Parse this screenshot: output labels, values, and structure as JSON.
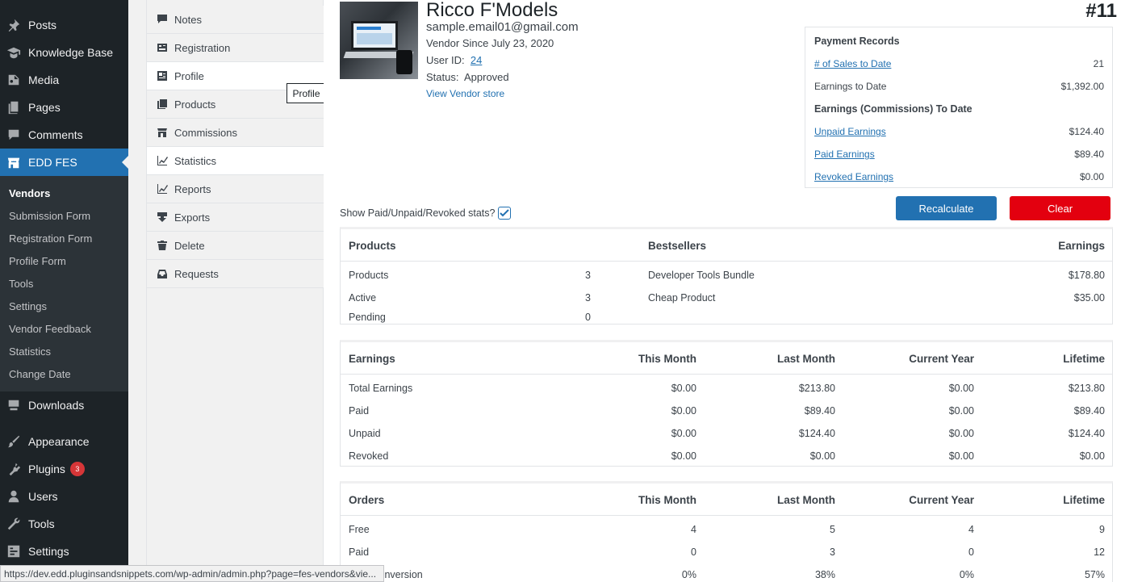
{
  "admin_menu": {
    "items": [
      {
        "label": "Posts",
        "icon": "pin-icon"
      },
      {
        "label": "Knowledge Base",
        "icon": "graduation-cap-icon"
      },
      {
        "label": "Media",
        "icon": "media-icon"
      },
      {
        "label": "Pages",
        "icon": "pages-icon"
      },
      {
        "label": "Comments",
        "icon": "comment-icon"
      },
      {
        "label": "EDD FES",
        "icon": "store-icon"
      },
      {
        "label": "Downloads",
        "icon": "download-icon"
      },
      {
        "label": "Appearance",
        "icon": "brush-icon"
      },
      {
        "label": "Plugins",
        "icon": "plugin-icon",
        "badge": "3"
      },
      {
        "label": "Users",
        "icon": "user-icon"
      },
      {
        "label": "Tools",
        "icon": "wrench-icon"
      },
      {
        "label": "Settings",
        "icon": "settings-icon"
      }
    ],
    "submenu": [
      "Vendors",
      "Submission Form",
      "Registration Form",
      "Profile Form",
      "Tools",
      "Settings",
      "Vendor Feedback",
      "Statistics",
      "Change Date"
    ]
  },
  "vendor_tabs": [
    {
      "label": "Notes",
      "icon": "comment-icon"
    },
    {
      "label": "Registration",
      "icon": "form-icon"
    },
    {
      "label": "Profile",
      "icon": "profile-icon"
    },
    {
      "label": "Products",
      "icon": "products-icon"
    },
    {
      "label": "Commissions",
      "icon": "store-icon"
    },
    {
      "label": "Statistics",
      "icon": "chart-line-icon"
    },
    {
      "label": "Reports",
      "icon": "chart-line-icon"
    },
    {
      "label": "Exports",
      "icon": "export-icon"
    },
    {
      "label": "Delete",
      "icon": "trash-icon"
    },
    {
      "label": "Requests",
      "icon": "inbox-icon"
    }
  ],
  "tooltip": "Profile",
  "vendor": {
    "name": "Ricco F'Models",
    "email": "sample.email01@gmail.com",
    "since": "Vendor Since July 23, 2020",
    "user_id_label": "User ID:",
    "user_id": "24",
    "status_label": "Status:",
    "status": "Approved",
    "store_link": "View Vendor store",
    "number": "#11"
  },
  "payment_records": {
    "title": "Payment Records",
    "sales_label": "# of Sales to Date",
    "sales_value": "21",
    "earnings_label": "Earnings to Date",
    "earnings_value": "$1,392.00",
    "commissions_title": "Earnings (Commissions) To Date",
    "unpaid_label": "Unpaid Earnings",
    "unpaid_value": "$124.40",
    "paid_label": "Paid Earnings",
    "paid_value": "$89.40",
    "revoked_label": "Revoked Earnings",
    "revoked_value": "$0.00"
  },
  "buttons": {
    "recalculate": "Recalculate",
    "clear": "Clear"
  },
  "show_stats_label": "Show Paid/Unpaid/Revoked stats?",
  "products_table": {
    "headers": [
      "Products",
      "Bestsellers",
      "Earnings"
    ],
    "rows": [
      {
        "label": "Products",
        "count": "3",
        "bestseller": "Developer Tools Bundle",
        "earnings": "$178.80"
      },
      {
        "label": "Active",
        "count": "3",
        "bestseller": "Cheap Product",
        "earnings": "$35.00"
      },
      {
        "label": "Pending",
        "count": "0",
        "bestseller": "",
        "earnings": ""
      }
    ]
  },
  "earnings_table": {
    "headers": [
      "Earnings",
      "This Month",
      "Last Month",
      "Current Year",
      "Lifetime"
    ],
    "rows": [
      [
        "Total Earnings",
        "$0.00",
        "$213.80",
        "$0.00",
        "$213.80"
      ],
      [
        "Paid",
        "$0.00",
        "$89.40",
        "$0.00",
        "$89.40"
      ],
      [
        "Unpaid",
        "$0.00",
        "$124.40",
        "$0.00",
        "$124.40"
      ],
      [
        "Revoked",
        "$0.00",
        "$0.00",
        "$0.00",
        "$0.00"
      ]
    ]
  },
  "orders_table": {
    "headers": [
      "Orders",
      "This Month",
      "Last Month",
      "Current Year",
      "Lifetime"
    ],
    "rows": [
      [
        "Free",
        "4",
        "5",
        "4",
        "9"
      ],
      [
        "Paid",
        "0",
        "3",
        "0",
        "12"
      ],
      [
        "Paid Conversion",
        "0%",
        "38%",
        "0%",
        "57%"
      ]
    ]
  },
  "status_bar_url": "https://dev.edd.pluginsandsnippets.com/wp-admin/admin.php?page=fes-vendors&vie..."
}
